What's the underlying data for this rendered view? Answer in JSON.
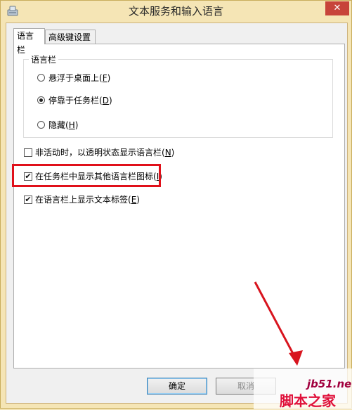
{
  "window": {
    "title": "文本服务和输入语言",
    "close_glyph": "✕"
  },
  "tabs": [
    {
      "label": "语言栏",
      "active": true
    },
    {
      "label": "高级键设置",
      "active": false
    }
  ],
  "language_bar_group": {
    "legend": "语言栏",
    "options": [
      {
        "label": "悬浮于桌面上(",
        "key": "F",
        "tail": ")",
        "selected": false
      },
      {
        "label": "停靠于任务栏(",
        "key": "D",
        "tail": ")",
        "selected": true
      },
      {
        "label": "隐藏(",
        "key": "H",
        "tail": ")",
        "selected": false
      }
    ]
  },
  "checkboxes": [
    {
      "label": "非活动时，以透明状态显示语言栏(",
      "key": "N",
      "tail": ")",
      "checked": false
    },
    {
      "label": "在任务栏中显示其他语言栏图标(",
      "key": "I",
      "tail": ")",
      "checked": true
    },
    {
      "label": "在语言栏上显示文本标签(",
      "key": "E",
      "tail": ")",
      "checked": true
    }
  ],
  "buttons": {
    "ok": "确定",
    "cancel": "取消"
  },
  "watermark": {
    "site": "jb51.net",
    "logo": "脚本之家"
  },
  "colors": {
    "highlight": "#e0101a",
    "title_bg": "#f5e5b5"
  }
}
